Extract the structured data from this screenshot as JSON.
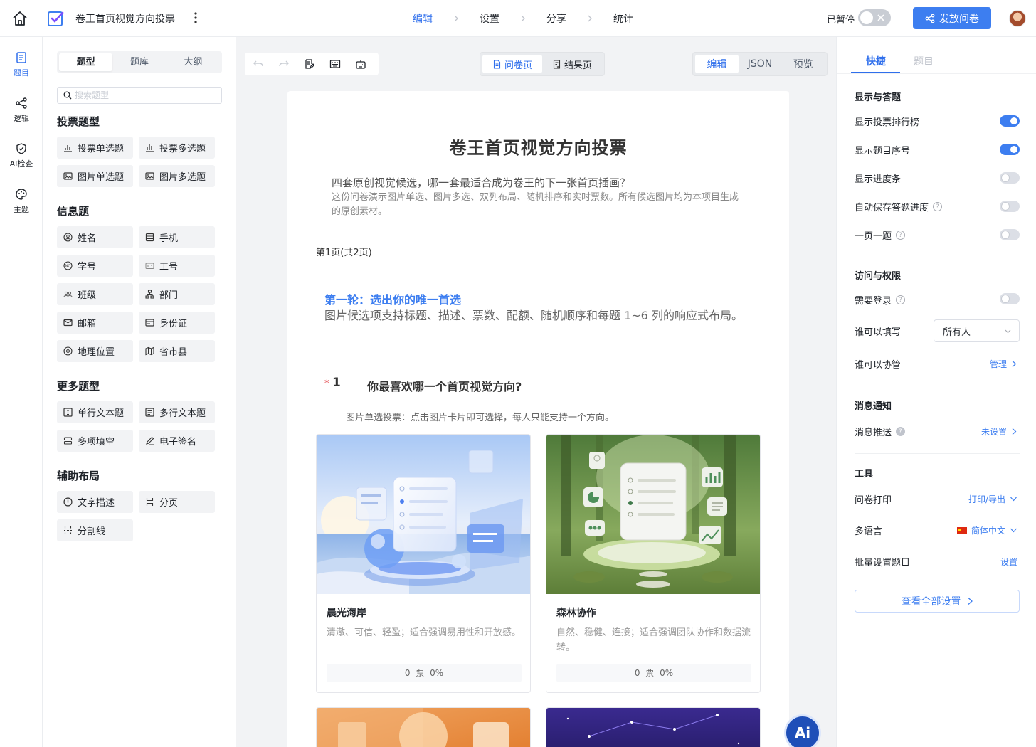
{
  "header": {
    "title": "卷王首页视觉方向投票",
    "steps": [
      "编辑",
      "设置",
      "分享",
      "统计"
    ],
    "pause_label": "已暂停",
    "publish_label": "发放问卷",
    "accent": "#2f6fec"
  },
  "rail": [
    {
      "label": "题目",
      "icon": "list-icon"
    },
    {
      "label": "逻辑",
      "icon": "logic-icon"
    },
    {
      "label": "AI检查",
      "icon": "shield-check-icon"
    },
    {
      "label": "主题",
      "icon": "palette-icon"
    }
  ],
  "left_panel": {
    "tabs": [
      "题型",
      "题库",
      "大纲"
    ],
    "search_placeholder": "搜索题型",
    "groups": [
      {
        "title": "投票题型",
        "items": [
          "投票单选题",
          "投票多选题",
          "图片单选题",
          "图片多选题"
        ]
      },
      {
        "title": "信息题",
        "items": [
          "姓名",
          "手机",
          "学号",
          "工号",
          "班级",
          "部门",
          "邮箱",
          "身份证",
          "地理位置",
          "省市县"
        ]
      },
      {
        "title": "更多题型",
        "items": [
          "单行文本题",
          "多行文本题",
          "多项填空",
          "电子签名"
        ]
      },
      {
        "title": "辅助布局",
        "items": [
          "文字描述",
          "分页",
          "分割线"
        ]
      }
    ]
  },
  "canvas": {
    "page_tabs": [
      "问卷页",
      "结果页"
    ],
    "mode_tabs": [
      "编辑",
      "JSON",
      "预览"
    ],
    "survey_title": "卷王首页视觉方向投票",
    "desc_main": "四套原创视觉候选，哪一套最适合成为卷王的下一张首页插画？",
    "desc_sub": "这份问卷演示图片单选、图片多选、双列布局、随机排序和实时票数。所有候选图片均为本项目生成的原创素材。",
    "page_indicator": "第1页(共2页)",
    "section_title": "第一轮：选出你的唯一首选",
    "section_desc": "图片候选项支持标题、描述、票数、配额、随机顺序和每题 1~6 列的响应式布局。",
    "question": {
      "required_mark": "*",
      "number": "1",
      "title": "你最喜欢哪一个首页视觉方向?",
      "hint": "图片单选投票：点击图片卡片即可选择，每人只能支持一个方向。"
    },
    "options": [
      {
        "name": "晨光海岸",
        "desc": "清澈、可信、轻盈；适合强调易用性和开放感。",
        "votes": "0 票 0%"
      },
      {
        "name": "森林协作",
        "desc": "自然、稳健、连接；适合强调团队协作和数据流转。",
        "votes": "0 票 0%"
      }
    ],
    "ai_label": "Ai"
  },
  "right_panel": {
    "tabs": [
      "快捷",
      "题目"
    ],
    "sections": {
      "display": "显示与答题",
      "access": "访问与权限",
      "notify": "消息通知",
      "tools": "工具"
    },
    "display_rows": [
      {
        "label": "显示投票排行榜",
        "on": true
      },
      {
        "label": "显示题目序号",
        "on": true
      },
      {
        "label": "显示进度条",
        "on": false
      },
      {
        "label": "自动保存答题进度",
        "on": false
      },
      {
        "label": "一页一题",
        "on": false
      }
    ],
    "need_login": "需要登录",
    "who_fill": "谁可以填写",
    "who_fill_value": "所有人",
    "who_manage": "谁可以协管",
    "manage_link": "管理",
    "push": "消息推送",
    "push_link": "未设置",
    "print": "问卷打印",
    "print_link": "打印/导出",
    "lang": "多语言",
    "lang_link": "简体中文",
    "batch": "批量设置题目",
    "batch_link": "设置",
    "view_all": "查看全部设置",
    "help_mark": "?"
  }
}
